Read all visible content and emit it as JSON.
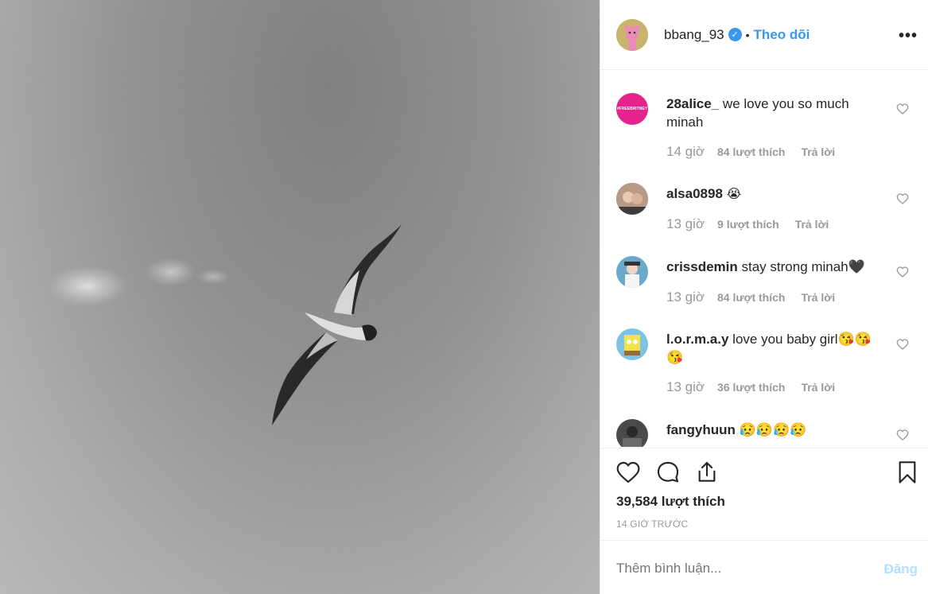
{
  "post": {
    "author": "bbang_93",
    "follow_label": "Theo dõi",
    "separator": "•",
    "likes": "39,584 lượt thích",
    "timestamp": "14 GIỜ TRƯỚC"
  },
  "comments": [
    {
      "user": "28alice_",
      "text": "we love you so much minah",
      "time": "14 giờ",
      "likes": "84 lượt thích",
      "reply": "Trả lời",
      "avatar_label": "#FREEBRITNEY"
    },
    {
      "user": "alsa0898",
      "text": "😭",
      "time": "13 giờ",
      "likes": "9 lượt thích",
      "reply": "Trả lời"
    },
    {
      "user": "crissdemin",
      "text": "stay strong minah🖤",
      "time": "13 giờ",
      "likes": "84 lượt thích",
      "reply": "Trả lời"
    },
    {
      "user": "l.o.r.m.a.y",
      "text": "love you baby girl😘😘😘",
      "time": "13 giờ",
      "likes": "36 lượt thích",
      "reply": "Trả lời"
    },
    {
      "user": "fangyhuun",
      "text": "😥😥😥😥"
    }
  ],
  "add_comment": {
    "placeholder": "Thêm bình luận...",
    "post_label": "Đăng"
  },
  "icons": {
    "verified": "verified-badge-icon",
    "more": "more-options-icon",
    "like": "heart-icon",
    "comment": "comment-bubble-icon",
    "share": "share-icon",
    "save": "bookmark-icon"
  },
  "colors": {
    "accent": "#3897f0",
    "post_disabled": "#b2dffc",
    "muted": "#999999",
    "avatar_pink": "#e6228d"
  }
}
